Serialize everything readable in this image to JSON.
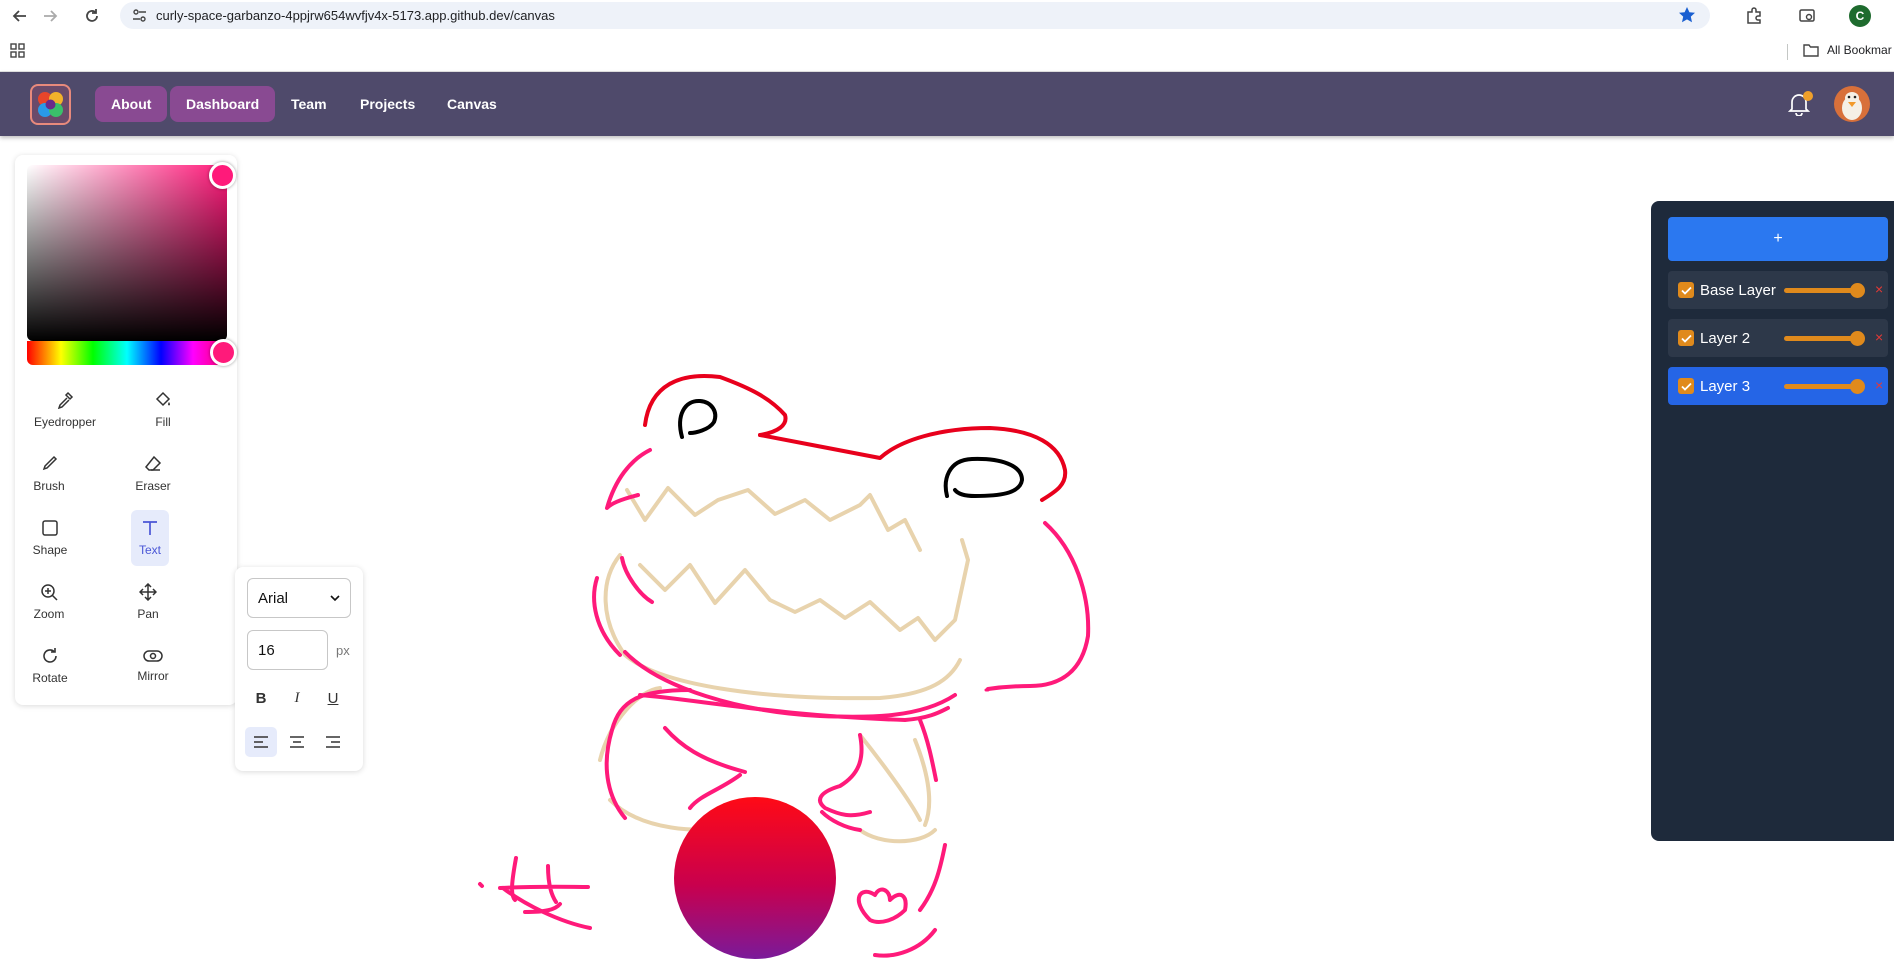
{
  "browser": {
    "url": "curly-space-garbanzo-4ppjrw654wvfjv4x-5173.app.github.dev/canvas",
    "profile_initial": "C",
    "bookmarks_label": "All Bookmar"
  },
  "header": {
    "nav": [
      "About",
      "Dashboard",
      "Team",
      "Projects",
      "Canvas"
    ]
  },
  "color_picker": {
    "selected_color": "#ff1a7a",
    "saturation": 1.0,
    "value": 1.0,
    "hue_position": 0.97
  },
  "tools": [
    {
      "label": "Eyedropper",
      "icon": "eyedropper-icon"
    },
    {
      "label": "Fill",
      "icon": "paint-bucket-icon"
    },
    {
      "label": "Brush",
      "icon": "brush-icon"
    },
    {
      "label": "Eraser",
      "icon": "eraser-icon"
    },
    {
      "label": "Shape",
      "icon": "square-icon"
    },
    {
      "label": "Text",
      "icon": "text-icon"
    },
    {
      "label": "Zoom",
      "icon": "zoom-in-icon"
    },
    {
      "label": "Pan",
      "icon": "move-icon"
    },
    {
      "label": "Rotate",
      "icon": "rotate-icon"
    },
    {
      "label": "Mirror",
      "icon": "mirror-icon"
    }
  ],
  "active_tool": "Text",
  "text_options": {
    "font": "Arial",
    "size": "16",
    "unit": "px",
    "bold": "B",
    "italic": "I",
    "underline": "U",
    "alignment": "left"
  },
  "layers": {
    "add_label": "+",
    "items": [
      {
        "name": "Base Layer",
        "visible": true,
        "opacity": 1.0
      },
      {
        "name": "Layer 2",
        "visible": true,
        "opacity": 1.0
      },
      {
        "name": "Layer 3",
        "visible": true,
        "opacity": 1.0
      }
    ],
    "selected": "Layer 3",
    "delete_label": "×"
  },
  "colors": {
    "header_bg": "#4f4a6b",
    "nav_active": "#894a92",
    "layers_bg": "#1e2a3b",
    "accent_blue": "#2b78f0",
    "slider_orange": "#e08a1c",
    "stroke_pink": "#ff1a7a",
    "stroke_red": "#e8001c",
    "stroke_tan": "#e8d3ad",
    "stroke_black": "#000000"
  }
}
